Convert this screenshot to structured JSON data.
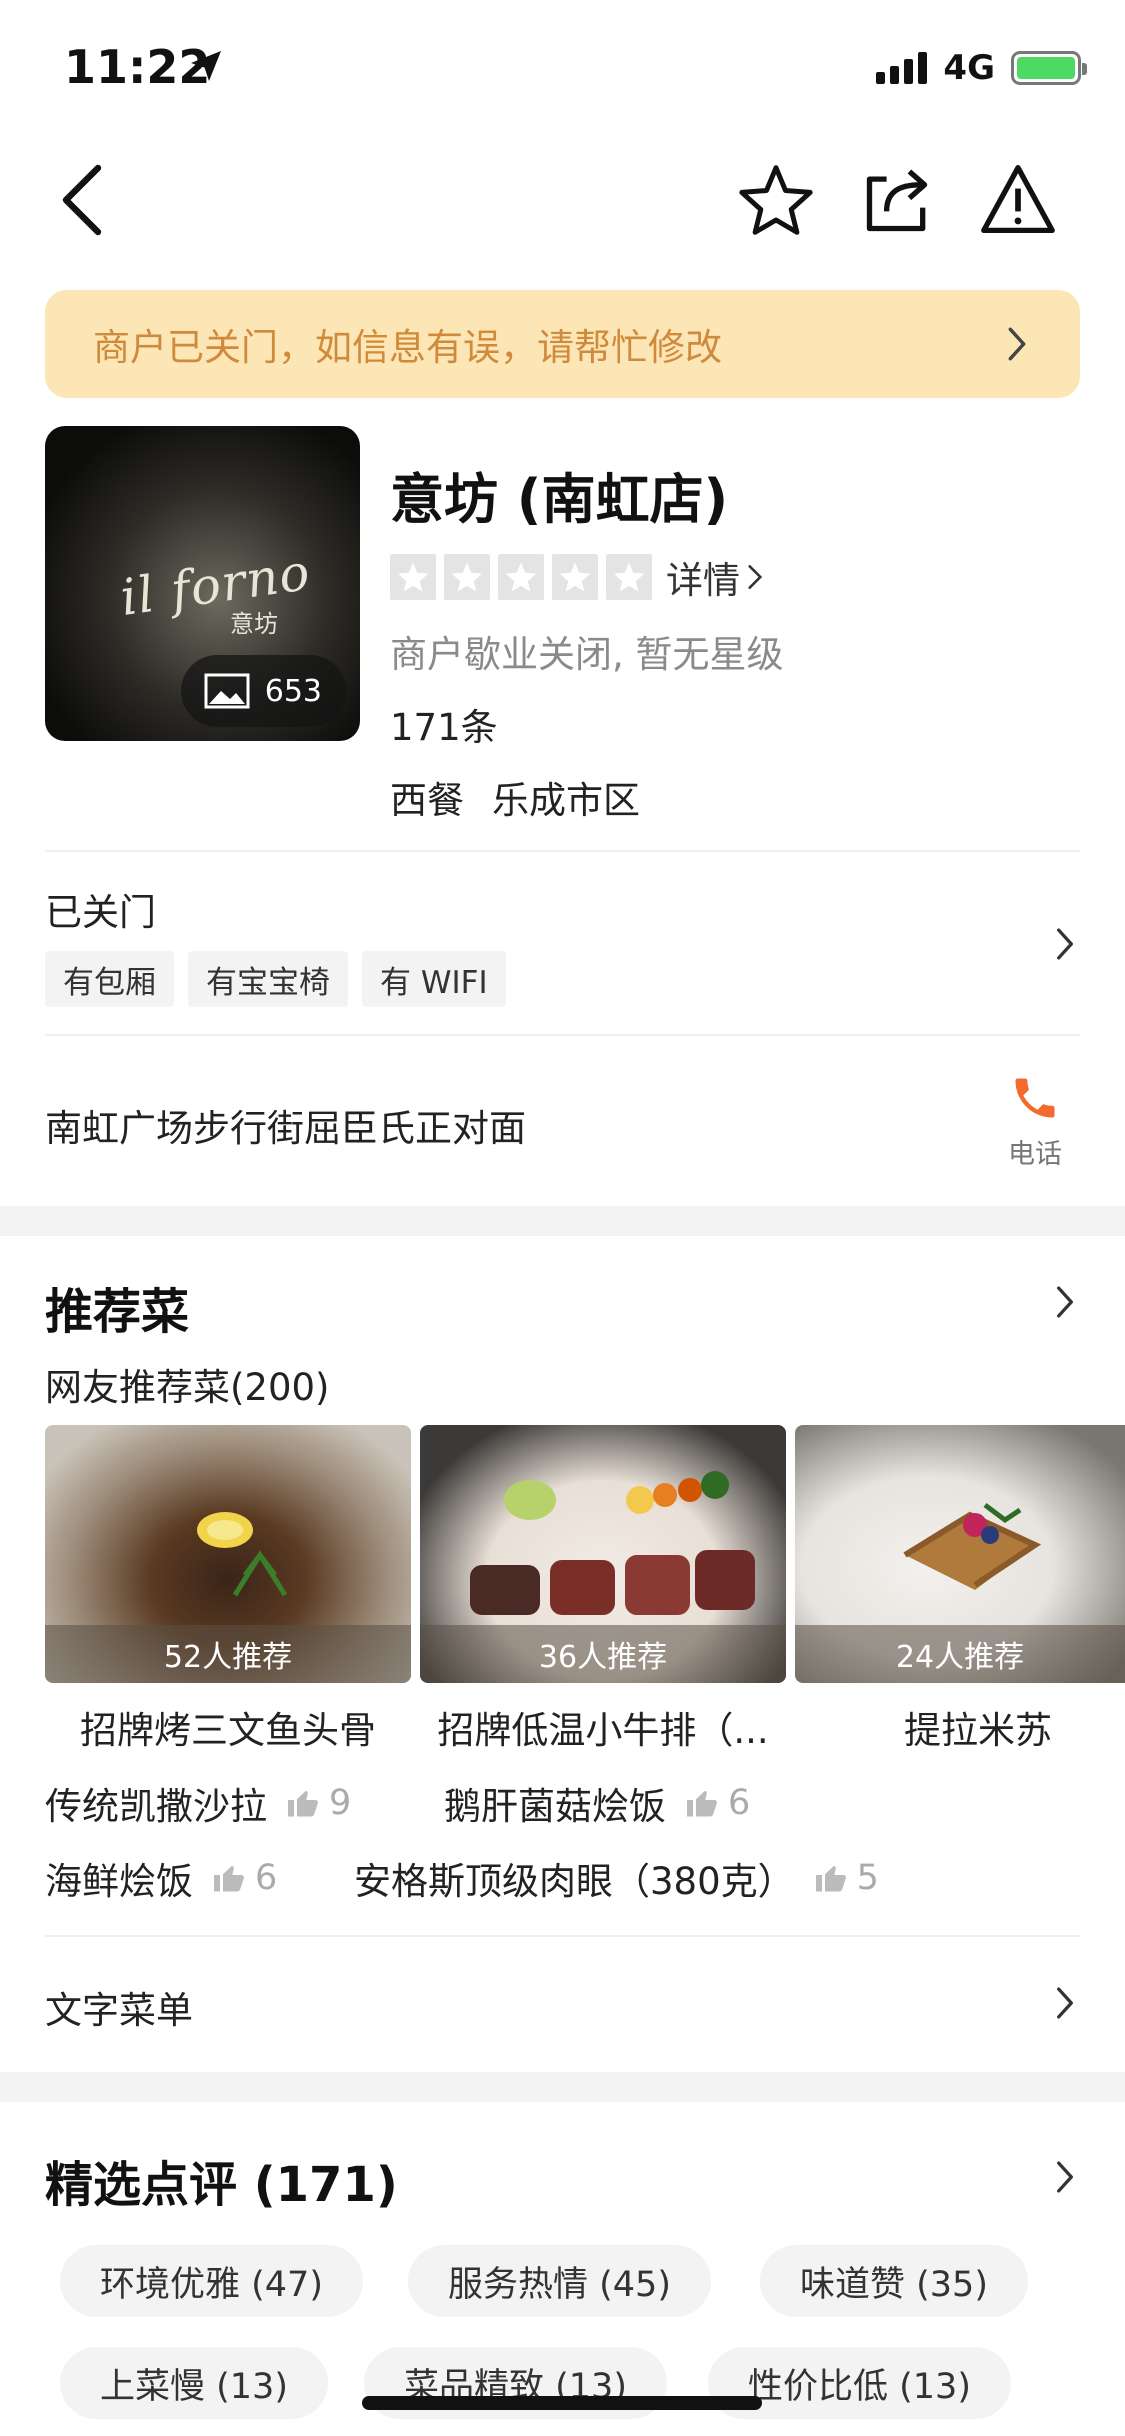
{
  "status_bar": {
    "time": "11:22",
    "network": "4G",
    "battery_level": 0.9
  },
  "nav": {
    "back_icon": "chevron-left-icon",
    "actions": [
      "star-outline-icon",
      "share-icon",
      "warning-icon"
    ]
  },
  "banner": {
    "text": "商户已关门，如信息有误，请帮忙修改"
  },
  "shop": {
    "name": "意坊 (南虹店)",
    "photo_logo": "il forno",
    "photo_logo_sub": "意坊",
    "photo_count": "653",
    "star_count_filled": 0,
    "stars_detail": "详情",
    "status": "商户歇业关闭, 暂无星级",
    "review_count": "171条",
    "category": "西餐",
    "area": "乐成市区"
  },
  "info": {
    "hours": "已关门",
    "facilities": [
      "有包厢",
      "有宝宝椅",
      "有 WIFI"
    ],
    "address": "南虹广场步行街屈臣氏正对面",
    "phone_label": "电话"
  },
  "recommended": {
    "title": "推荐菜",
    "subtitle": "网友推荐菜(200)",
    "dishes": [
      {
        "name": "招牌烤三文鱼头骨",
        "badge": "52人推荐"
      },
      {
        "name": "招牌低温小牛排（...",
        "badge": "36人推荐"
      },
      {
        "name": "提拉米苏",
        "badge": "24人推荐"
      }
    ],
    "more": [
      {
        "name": "传统凯撒沙拉",
        "likes": "9"
      },
      {
        "name": "鹅肝菌菇烩饭",
        "likes": "6"
      },
      {
        "name": "海鲜烩饭",
        "likes": "6"
      },
      {
        "name": "安格斯顶级肉眼（380克）",
        "likes": "5"
      }
    ],
    "text_menu": "文字菜单"
  },
  "reviews": {
    "title": "精选点评 (171)",
    "tags": [
      "环境优雅 (47)",
      "服务热情 (45)",
      "味道赞 (35)",
      "上菜慢 (13)",
      "菜品精致 (13)",
      "性价比低 (13)"
    ]
  },
  "colors": {
    "banner_bg": "#fde6b5",
    "banner_text": "#d08a3c",
    "phone_orange": "#f26a2e"
  }
}
